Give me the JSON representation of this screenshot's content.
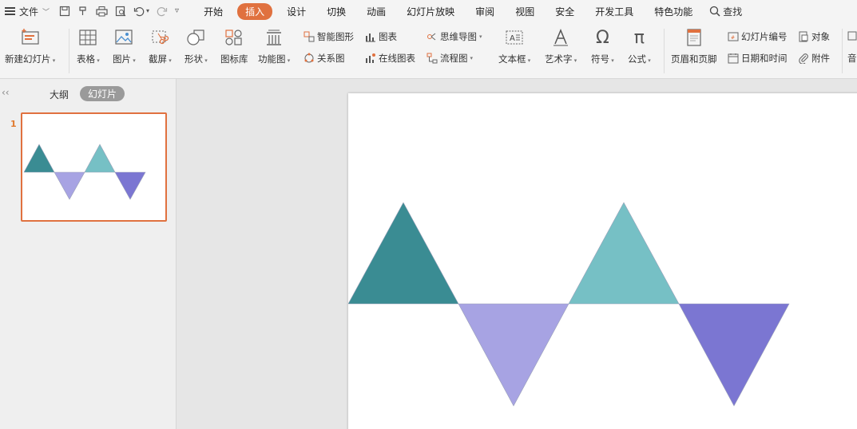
{
  "menubar": {
    "file_label": "文件",
    "tabs": [
      {
        "label": "开始",
        "active": false
      },
      {
        "label": "插入",
        "active": true
      },
      {
        "label": "设计",
        "active": false
      },
      {
        "label": "切换",
        "active": false
      },
      {
        "label": "动画",
        "active": false
      },
      {
        "label": "幻灯片放映",
        "active": false
      },
      {
        "label": "审阅",
        "active": false
      },
      {
        "label": "视图",
        "active": false
      },
      {
        "label": "安全",
        "active": false
      },
      {
        "label": "开发工具",
        "active": false
      },
      {
        "label": "特色功能",
        "active": false
      }
    ],
    "search_label": "查找",
    "accent_color": "#e0713f"
  },
  "toolbar": {
    "new_slide": "新建幻灯片",
    "table": "表格",
    "picture": "图片",
    "screenshot": "截屏",
    "shape": "形状",
    "icon_lib": "图标库",
    "function_chart": "功能图",
    "smart_art": "智能图形",
    "chart": "图表",
    "relation_chart": "关系图",
    "online_chart": "在线图表",
    "mind_map": "思维导图",
    "flow_chart": "流程图",
    "text_box": "文本框",
    "word_art": "艺术字",
    "symbol": "符号",
    "formula": "公式",
    "header_footer": "页眉和页脚",
    "slide_number": "幻灯片编号",
    "object": "对象",
    "date_time": "日期和时间",
    "attachment": "附件",
    "audio_partial": "音"
  },
  "left_panel": {
    "outline_tab": "大纲",
    "slides_tab": "幻灯片",
    "slide_number": "1"
  },
  "slide": {
    "triangle_colors": [
      "#3a8c93",
      "#a7a3e3",
      "#76c0c5",
      "#7b76d2"
    ]
  }
}
